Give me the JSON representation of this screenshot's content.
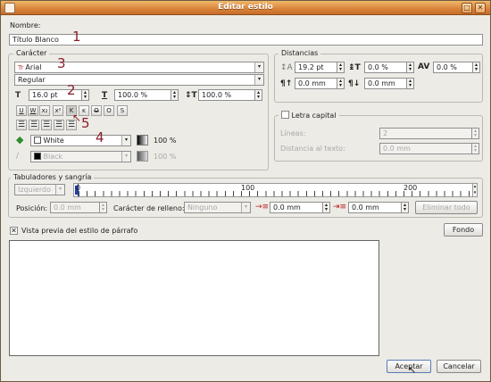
{
  "window": {
    "title": "Editar estilo"
  },
  "name_label": "Nombre:",
  "name_value": "Título Blanco",
  "character": {
    "group_title": "Carácter",
    "font": "Arial",
    "style": "Regular",
    "font_size": "16.0 pt",
    "scale_h": "100.0 %",
    "scale_v": "100.0 %",
    "text_styles": [
      "U",
      "W",
      "x₂",
      "x²",
      "K",
      "ĸ",
      "O",
      "O",
      "S"
    ],
    "fill_color": "White",
    "fill_shade": "100 %",
    "stroke_color": "Black",
    "stroke_shade": "100 %"
  },
  "distances": {
    "group_title": "Distancias",
    "line_spacing": "19.2 pt",
    "space_above": "0.0 %",
    "tracking": "0.0 %",
    "space_before": "0.0 mm",
    "space_after": "0.0 mm"
  },
  "dropcap": {
    "title": "Letra capital",
    "lines_label": "Líneas:",
    "lines_value": "2",
    "offset_label": "Distancia al texto:",
    "offset_value": "0.0 mm"
  },
  "tabs": {
    "group_title": "Tabuladores y sangría",
    "alignment": "Izquierdo",
    "ruler_labels": [
      "0",
      "100",
      "200"
    ],
    "position_label": "Posición:",
    "position_value": "0.0 mm",
    "fill_label": "Carácter de relleno:",
    "fill_value": "Ninguno",
    "indent_first": "0.0 mm",
    "indent_left": "0.0 mm",
    "delete_all": "Eliminar todo"
  },
  "preview": {
    "checkbox_label": "Vista previa del estilo de párrafo",
    "background_button": "Fondo"
  },
  "footer": {
    "accept": "Aceptar",
    "cancel": "Cancelar"
  },
  "annotations": [
    "1",
    "2",
    "3",
    "4",
    "5"
  ],
  "colors": {
    "titlebar": "#d9823a",
    "annotation": "#8b1e2b",
    "fill_icon": "#2e8b2e"
  }
}
